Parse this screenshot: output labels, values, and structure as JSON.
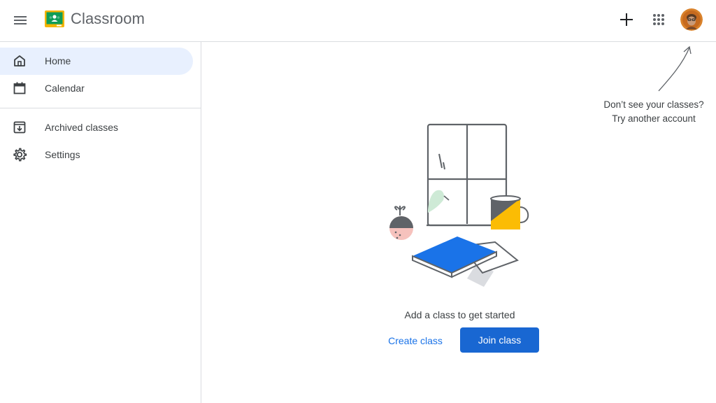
{
  "header": {
    "app_title": "Classroom",
    "icons": {
      "menu": "hamburger-menu-icon",
      "logo": "classroom-logo-icon",
      "add": "plus-icon",
      "apps": "apps-grid-icon",
      "account": "user-avatar"
    }
  },
  "sidebar": {
    "items": [
      {
        "label": "Home",
        "icon": "home-icon",
        "active": true
      },
      {
        "label": "Calendar",
        "icon": "calendar-icon",
        "active": false
      },
      {
        "label": "Archived classes",
        "icon": "archive-icon",
        "active": false
      },
      {
        "label": "Settings",
        "icon": "gear-icon",
        "active": false
      }
    ]
  },
  "account_hint": {
    "line1": "Don’t see your classes?",
    "line2": "Try another account"
  },
  "empty_state": {
    "message": "Add a class to get started",
    "create_label": "Create class",
    "join_label": "Join class"
  },
  "colors": {
    "accent": "#1a73e8",
    "button": "#1967d2",
    "active_nav": "#e8f0fe",
    "divider": "#dadce0",
    "logo_green": "#0f9d58",
    "logo_yellow": "#f4b400"
  }
}
